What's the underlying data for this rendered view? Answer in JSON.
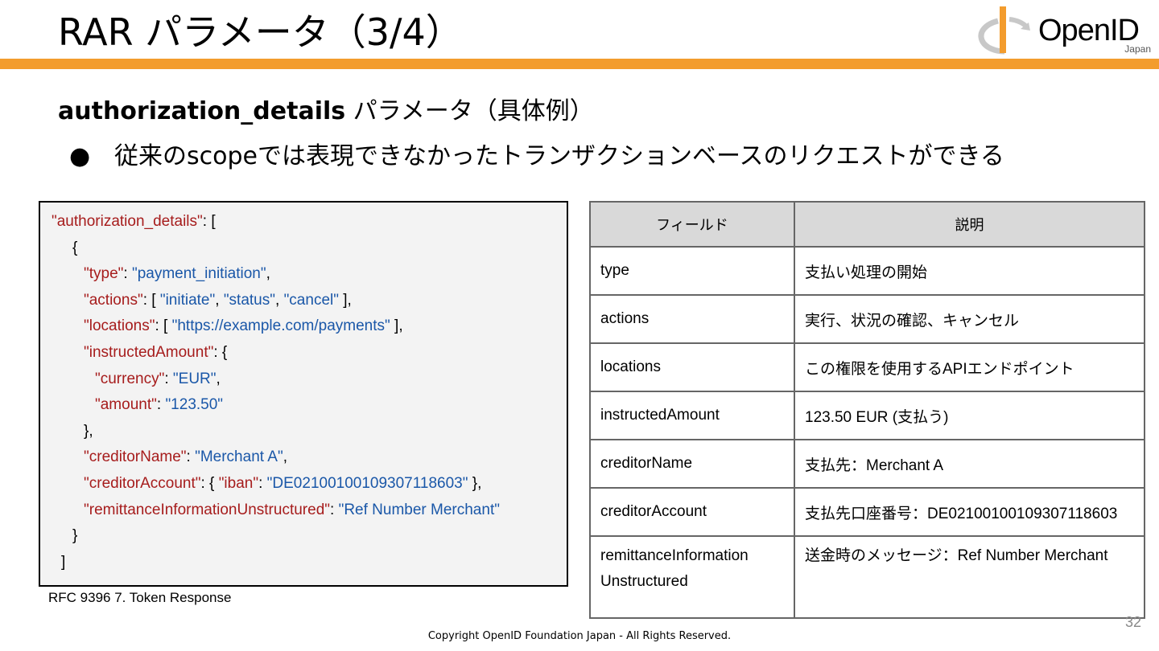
{
  "slide": {
    "title": "RAR パラメータ（3/4）",
    "subtitle_bold": "authorization_details",
    "subtitle_rest": " パラメータ（具体例）",
    "bullet_dot": "●",
    "bullet_text": "従来のscopeでは表現できなかったトランザクションベースのリクエストができる",
    "page_number": "32",
    "copyright": "Copyright OpenID Foundation Japan - All Rights Reserved."
  },
  "logo": {
    "name": "OpenID",
    "sub": "Japan",
    "icon": "openid-logo-icon",
    "accent": "#f39c2d"
  },
  "code": {
    "lines": [
      {
        "indent": 14,
        "parts": [
          {
            "t": "\"authorization_details\"",
            "c": "k"
          },
          {
            "t": ": [",
            "c": "p"
          }
        ]
      },
      {
        "indent": 40,
        "parts": [
          {
            "t": "{",
            "c": "p"
          }
        ]
      },
      {
        "indent": 54,
        "parts": [
          {
            "t": "\"type\"",
            "c": "k"
          },
          {
            "t": ": ",
            "c": "p"
          },
          {
            "t": "\"payment_initiation\"",
            "c": "v"
          },
          {
            "t": ",",
            "c": "p"
          }
        ]
      },
      {
        "indent": 54,
        "parts": [
          {
            "t": "\"actions\"",
            "c": "k"
          },
          {
            "t": ": [ ",
            "c": "p"
          },
          {
            "t": "\"initiate\"",
            "c": "v"
          },
          {
            "t": ", ",
            "c": "p"
          },
          {
            "t": "\"status\"",
            "c": "v"
          },
          {
            "t": ", ",
            "c": "p"
          },
          {
            "t": "\"cancel\"",
            "c": "v"
          },
          {
            "t": "  ],",
            "c": "p"
          }
        ]
      },
      {
        "indent": 54,
        "parts": [
          {
            "t": "\"locations\"",
            "c": "k"
          },
          {
            "t": ": [ ",
            "c": "p"
          },
          {
            "t": "\"https://example.com/payments\"",
            "c": "v"
          },
          {
            "t": " ],",
            "c": "p"
          }
        ]
      },
      {
        "indent": 54,
        "parts": [
          {
            "t": "\"instructedAmount\"",
            "c": "k"
          },
          {
            "t": ": {",
            "c": "p"
          }
        ]
      },
      {
        "indent": 68,
        "parts": [
          {
            "t": "\"currency\"",
            "c": "k"
          },
          {
            "t": ": ",
            "c": "p"
          },
          {
            "t": "\"EUR\"",
            "c": "v"
          },
          {
            "t": ",",
            "c": "p"
          }
        ]
      },
      {
        "indent": 68,
        "parts": [
          {
            "t": "\"amount\"",
            "c": "k"
          },
          {
            "t": ": ",
            "c": "p"
          },
          {
            "t": "\"123.50\"",
            "c": "v"
          }
        ]
      },
      {
        "indent": 54,
        "parts": [
          {
            "t": "},",
            "c": "p"
          }
        ]
      },
      {
        "indent": 54,
        "parts": [
          {
            "t": "\"creditorName\"",
            "c": "k"
          },
          {
            "t": ": ",
            "c": "p"
          },
          {
            "t": "\"Merchant A\"",
            "c": "v"
          },
          {
            "t": ",",
            "c": "p"
          }
        ]
      },
      {
        "indent": 54,
        "parts": [
          {
            "t": "\"creditorAccount\"",
            "c": "k"
          },
          {
            "t": ": {  ",
            "c": "p"
          },
          {
            "t": "\"iban\"",
            "c": "k"
          },
          {
            "t": ": ",
            "c": "p"
          },
          {
            "t": "\"DE02100100109307118603\"",
            "c": "v"
          },
          {
            "t": "  },",
            "c": "p"
          }
        ]
      },
      {
        "indent": 54,
        "parts": [
          {
            "t": "\"remittanceInformationUnstructured\"",
            "c": "k"
          },
          {
            "t": ": ",
            "c": "p"
          },
          {
            "t": "\"Ref Number Merchant\"",
            "c": "v"
          }
        ]
      },
      {
        "indent": 40,
        "parts": [
          {
            "t": "}",
            "c": "p"
          }
        ]
      },
      {
        "indent": 26,
        "parts": [
          {
            "t": "]",
            "c": "p"
          }
        ]
      }
    ],
    "caption": "RFC 9396  7. Token Response"
  },
  "table": {
    "headers": [
      "フィールド",
      "説明"
    ],
    "rows": [
      [
        "type",
        "支払い処理の開始"
      ],
      [
        "actions",
        "実行、状況の確認、キャンセル"
      ],
      [
        "locations",
        "この権限を使用するAPIエンドポイント"
      ],
      [
        "instructedAmount",
        "123.50 EUR (支払う)"
      ],
      [
        "creditorName",
        "支払先：Merchant A"
      ],
      [
        "creditorAccount",
        "支払先口座番号：DE02100100109307118603"
      ],
      [
        "remittanceInformation\nUnstructured",
        "送金時のメッセージ：Ref Number Merchant"
      ]
    ]
  }
}
